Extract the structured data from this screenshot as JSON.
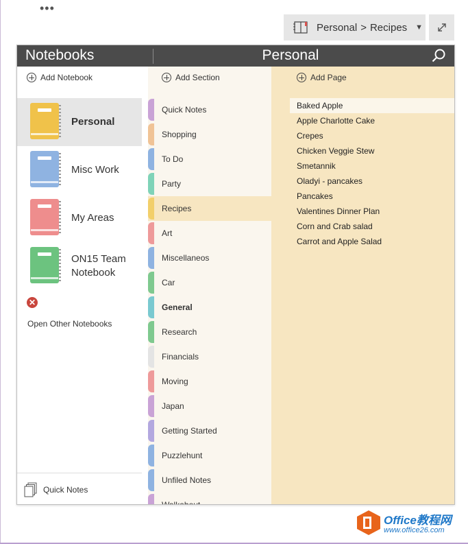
{
  "toolbar": {
    "more_label": "•••",
    "breadcrumb": {
      "notebook": "Personal",
      "separator": ">",
      "section": "Recipes"
    },
    "expand_icon": "expand-icon"
  },
  "header": {
    "notebooks_title": "Notebooks",
    "current_notebook": "Personal",
    "search_icon": "search-icon"
  },
  "notebooks": {
    "add_label": "Add Notebook",
    "items": [
      {
        "line1": "Personal",
        "line2": "",
        "color": "#f0c24a",
        "selected": true
      },
      {
        "line1": "Misc Work",
        "line2": "",
        "color": "#8fb3e1",
        "selected": false
      },
      {
        "line1": "My Areas",
        "line2": "",
        "color": "#ee8d8d",
        "selected": false
      },
      {
        "line1": "ON15 Team",
        "line2": "Notebook",
        "color": "#6cc37f",
        "selected": false
      }
    ],
    "open_other_label": "Open Other Notebooks",
    "quick_notes_label": "Quick Notes"
  },
  "sections": {
    "add_label": "Add Section",
    "items": [
      {
        "name": "Quick Notes",
        "color": "#c9a3d6"
      },
      {
        "name": "Shopping",
        "color": "#f0c396"
      },
      {
        "name": "To Do",
        "color": "#8fb3e1"
      },
      {
        "name": "Party",
        "color": "#7fd3b8"
      },
      {
        "name": "Recipes",
        "color": "#f2cf6a",
        "selected": true
      },
      {
        "name": "Art",
        "color": "#ee9a9a"
      },
      {
        "name": "Miscellaneos",
        "color": "#8fb3e1"
      },
      {
        "name": "Car",
        "color": "#7fc98f"
      },
      {
        "name": "General",
        "color": "#7ac9d0",
        "bold": true
      },
      {
        "name": "Research",
        "color": "#7fc98f"
      },
      {
        "name": "Financials",
        "color": "#e4e4e4"
      },
      {
        "name": "Moving",
        "color": "#ee9a9a"
      },
      {
        "name": "Japan",
        "color": "#c9a3d6"
      },
      {
        "name": "Getting Started",
        "color": "#b3a8df"
      },
      {
        "name": "Puzzlehunt",
        "color": "#8fb3e1"
      },
      {
        "name": "Unfiled Notes",
        "color": "#8fb3e1"
      },
      {
        "name": "Walkabout",
        "color": "#c9a3d6"
      }
    ]
  },
  "pages": {
    "add_label": "Add Page",
    "items": [
      {
        "name": "Baked Apple",
        "selected": true
      },
      {
        "name": "Apple Charlotte Cake"
      },
      {
        "name": "Crepes"
      },
      {
        "name": "Chicken Veggie Stew"
      },
      {
        "name": "Smetannik"
      },
      {
        "name": "Oladyi - pancakes"
      },
      {
        "name": "Pancakes"
      },
      {
        "name": "Valentines Dinner Plan"
      },
      {
        "name": "Corn and Crab salad"
      },
      {
        "name": "Carrot and Apple Salad"
      }
    ]
  },
  "watermark": {
    "brand": "Office教程网",
    "url": "www.office26.com"
  }
}
